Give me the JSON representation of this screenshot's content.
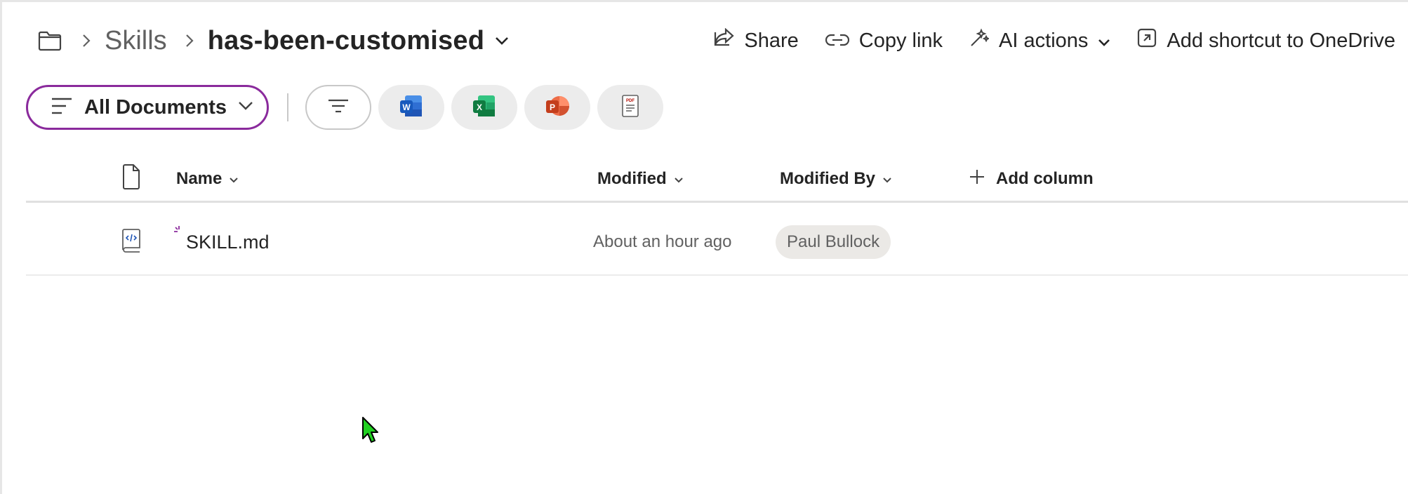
{
  "breadcrumb": {
    "items": [
      "Skills",
      "has-been-customised"
    ]
  },
  "actions": {
    "share": "Share",
    "copy_link": "Copy link",
    "ai_actions": "AI actions",
    "add_shortcut": "Add shortcut to OneDrive"
  },
  "view": {
    "current_view": "All Documents"
  },
  "file_type_filters": [
    {
      "name": "Word",
      "icon": "word-icon",
      "color": "#185abd"
    },
    {
      "name": "Excel",
      "icon": "excel-icon",
      "color": "#107c41"
    },
    {
      "name": "PowerPoint",
      "icon": "powerpoint-icon",
      "color": "#c43e1c"
    },
    {
      "name": "PDF",
      "icon": "pdf-icon",
      "color": "#b30b00"
    }
  ],
  "columns": {
    "name": "Name",
    "modified": "Modified",
    "modified_by": "Modified By",
    "add_column": "Add column"
  },
  "files": [
    {
      "name": "SKILL.md",
      "modified": "About an hour ago",
      "modified_by": "Paul Bullock",
      "icon": "code-file-icon"
    }
  ],
  "colors": {
    "accent": "#8a2a9c",
    "text": "#242424",
    "muted": "#616161"
  }
}
